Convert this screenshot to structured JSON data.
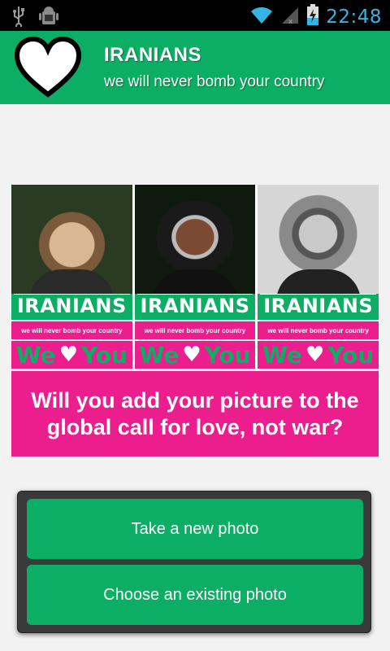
{
  "status_bar": {
    "time": "22:48",
    "icons": [
      "usb-icon",
      "android-debug-icon",
      "wifi-icon",
      "signal-icon",
      "battery-charging-icon"
    ]
  },
  "header": {
    "title": "IRANIANS",
    "subtitle": "we will never bomb your country",
    "logo_icon": "heart-icon"
  },
  "posters": [
    {
      "word": "IRANIANS",
      "tagline": "we will never bomb your country",
      "love_left": "We",
      "love_right": "You"
    },
    {
      "word": "IRANIANS",
      "tagline": "we will never bomb your country",
      "love_left": "We",
      "love_right": "You"
    },
    {
      "word": "IRANIANS",
      "tagline": "we will never bomb your country",
      "love_left": "We",
      "love_right": "You"
    }
  ],
  "callout": "Will you add your picture to the global call for love, not war?",
  "dialog": {
    "take_photo": "Take a new photo",
    "choose_photo": "Choose an existing photo"
  },
  "colors": {
    "brand_green": "#0cad64",
    "brand_pink": "#ec1e8e",
    "status_blue": "#33b5e5"
  }
}
